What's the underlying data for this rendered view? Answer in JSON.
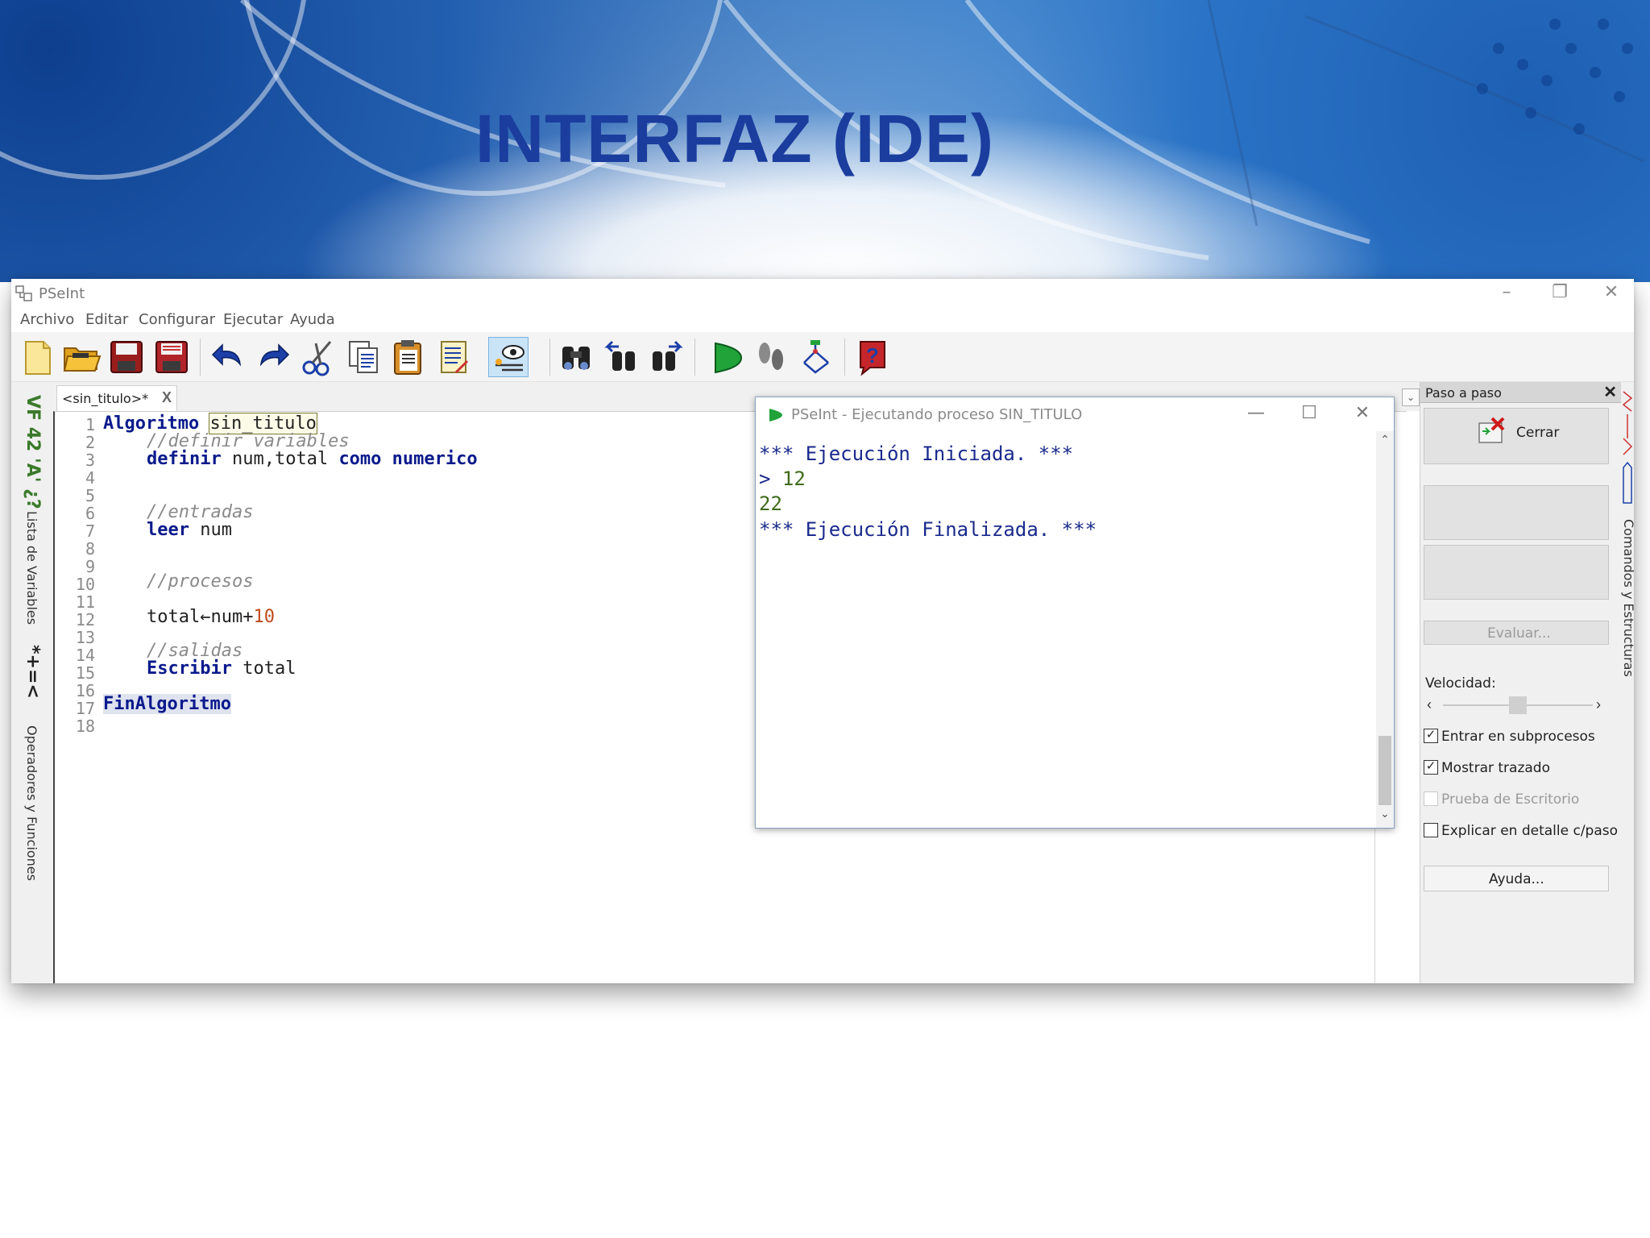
{
  "slide": {
    "title": "INTERFAZ (IDE)"
  },
  "window": {
    "title": "PSeInt",
    "controls": {
      "minimize": "–",
      "restore": "❐",
      "close": "✕"
    }
  },
  "menu": [
    "Archivo",
    "Editar",
    "Configurar",
    "Ejecutar",
    "Ayuda"
  ],
  "toolbar": {
    "icons": [
      "new-file-icon",
      "open-folder-icon",
      "save-icon",
      "save-as-icon",
      "undo-icon",
      "redo-icon",
      "cut-icon",
      "copy-icon",
      "paste-icon",
      "edit-list-icon",
      "debug-watch-icon",
      "find-icon",
      "find-previous-icon",
      "find-next-icon",
      "run-icon",
      "step-by-step-icon",
      "flowchart-icon",
      "help-icon"
    ]
  },
  "left_panel": {
    "variables_glyphs": "VF 42 'A' ¿?",
    "variables_label": "Lista de Variables",
    "operators_glyphs": "*+=<",
    "operators_label": "Operadores y Funciones"
  },
  "editor": {
    "tab_label": "<sin_titulo>*",
    "tab_close": "X",
    "dropdown_arrow": "⌄",
    "line_numbers": [
      "1",
      "2",
      "3",
      "4",
      "5",
      "6",
      "7",
      "8",
      "9",
      "10",
      "11",
      "12",
      "13",
      "14",
      "15",
      "16",
      "17",
      "18"
    ],
    "code": {
      "l1_kw": "Algoritmo",
      "l1_name": "sin_titulo",
      "l2_comment": "//definir variables",
      "l3_kw1": "definir",
      "l3_vars": "num,total",
      "l3_kw2": "como",
      "l3_kw3": "numerico",
      "l6_comment": "//entradas",
      "l7_kw": "leer",
      "l7_var": "num",
      "l10_comment": "//procesos",
      "l12_expr": "total←num+",
      "l12_num": "10",
      "l14_comment": "//salidas",
      "l15_kw": "Escribir",
      "l15_var": "total",
      "l17_kw": "FinAlgoritmo"
    }
  },
  "execution_window": {
    "title": "PSeInt - Ejecutando proceso SIN_TITULO",
    "controls": {
      "minimize": "—",
      "maximize": "☐",
      "close": "✕"
    },
    "console": {
      "line1": "*** Ejecución Iniciada. ***",
      "line2_prompt": ">",
      "line2_value": "12",
      "line3": "22",
      "line4": "*** Ejecución Finalizada. ***"
    },
    "scrollbar": {
      "up": "⌃",
      "down": "⌄"
    }
  },
  "step_panel": {
    "header": "Paso a paso",
    "header_close": "✕",
    "close_button": "Cerrar",
    "evaluate_button": "Evaluar...",
    "speed_label": "Velocidad:",
    "speed_left": "‹",
    "speed_right": "›",
    "speed_level": 0.5,
    "options": [
      {
        "label": "Entrar en subprocesos",
        "checked": true,
        "enabled": true
      },
      {
        "label": "Mostrar trazado",
        "checked": true,
        "enabled": true
      },
      {
        "label": "Prueba de Escritorio",
        "checked": false,
        "enabled": false
      },
      {
        "label": "Explicar en detalle c/paso",
        "checked": false,
        "enabled": true
      }
    ],
    "help_button": "Ayuda..."
  },
  "right_strip": {
    "label": "Comandos y Estructuras"
  }
}
